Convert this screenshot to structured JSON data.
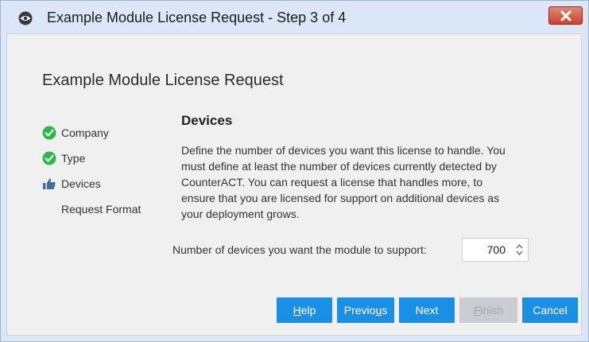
{
  "window": {
    "title": "Example Module License Request - Step 3 of 4",
    "icon": "eye-icon",
    "close_icon": "close-icon"
  },
  "heading": "Example Module License Request",
  "steps": [
    {
      "label": "Company",
      "status": "completed",
      "icon": "check-circle-icon"
    },
    {
      "label": "Type",
      "status": "completed",
      "icon": "check-circle-icon"
    },
    {
      "label": "Devices",
      "status": "current",
      "icon": "thumbs-up-icon"
    },
    {
      "label": "Request Format",
      "status": "pending",
      "icon": ""
    }
  ],
  "section": {
    "title": "Devices",
    "description_lines": [
      "Define the number of devices you want this license to handle. You",
      "must define at least the number of devices currently detected by",
      "CounterACT. You can request a license that handles more, to",
      "ensure that you are licensed for support on additional devices as",
      "your deployment grows."
    ]
  },
  "device_count": {
    "label": "Number of devices you want the module to support:",
    "value": "700"
  },
  "buttons": {
    "help": {
      "before": "",
      "mnemonic": "H",
      "after": "elp"
    },
    "previous": {
      "before": "Previo",
      "mnemonic": "u",
      "after": "s"
    },
    "next": {
      "before": "Next",
      "mnemonic": "",
      "after": ""
    },
    "finish": {
      "before": "",
      "mnemonic": "F",
      "after": "inish"
    },
    "cancel": {
      "before": "Cancel",
      "mnemonic": "",
      "after": ""
    }
  },
  "colors": {
    "titlebar": "#dbe7f6",
    "client": "#f0f0f0",
    "button": "#1a8fe6",
    "button_disabled": "#c9cdd2",
    "check": "#2eb84a",
    "close": "#c8432e"
  }
}
